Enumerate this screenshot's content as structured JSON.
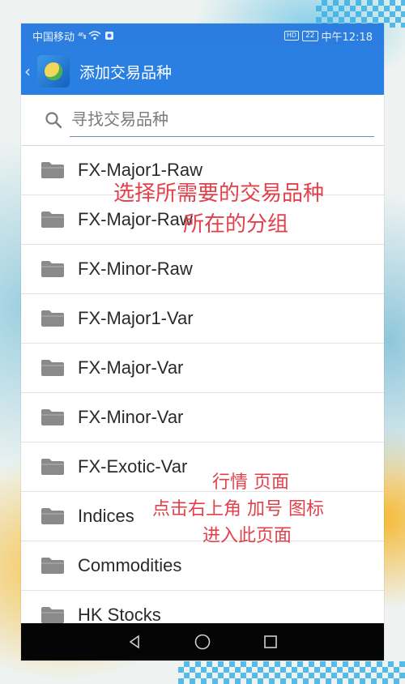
{
  "status_bar": {
    "carrier": "中国移动",
    "signal_glyph": "⁴⁶ᵢₗₗ",
    "hd": "HD",
    "battery": "22",
    "time": "中午12:18"
  },
  "app_bar": {
    "title": "添加交易品种",
    "back_icon": "chevron-left-icon",
    "logo_icon": "metatrader-logo-icon"
  },
  "search": {
    "placeholder": "寻找交易品种",
    "value": ""
  },
  "symbol_groups": [
    {
      "label": "FX-Major1-Raw"
    },
    {
      "label": "FX-Major-Raw"
    },
    {
      "label": "FX-Minor-Raw"
    },
    {
      "label": "FX-Major1-Var"
    },
    {
      "label": "FX-Major-Var"
    },
    {
      "label": "FX-Minor-Var"
    },
    {
      "label": "FX-Exotic-Var"
    },
    {
      "label": "Indices"
    },
    {
      "label": "Commodities"
    },
    {
      "label": "HK Stocks"
    }
  ],
  "annotations": {
    "group_hint_line1": "选择所需要的交易品种",
    "group_hint_line2": "所在的分组",
    "nav_hint_line1": "行情 页面",
    "nav_hint_line2": "点击右上角 加号 图标",
    "nav_hint_line3": "进入此页面"
  },
  "colors": {
    "app_bar": "#2a7fe2",
    "status_bar": "#2b7de0",
    "annotation": "#e2404a",
    "folder_icon": "#8a8a8a"
  }
}
